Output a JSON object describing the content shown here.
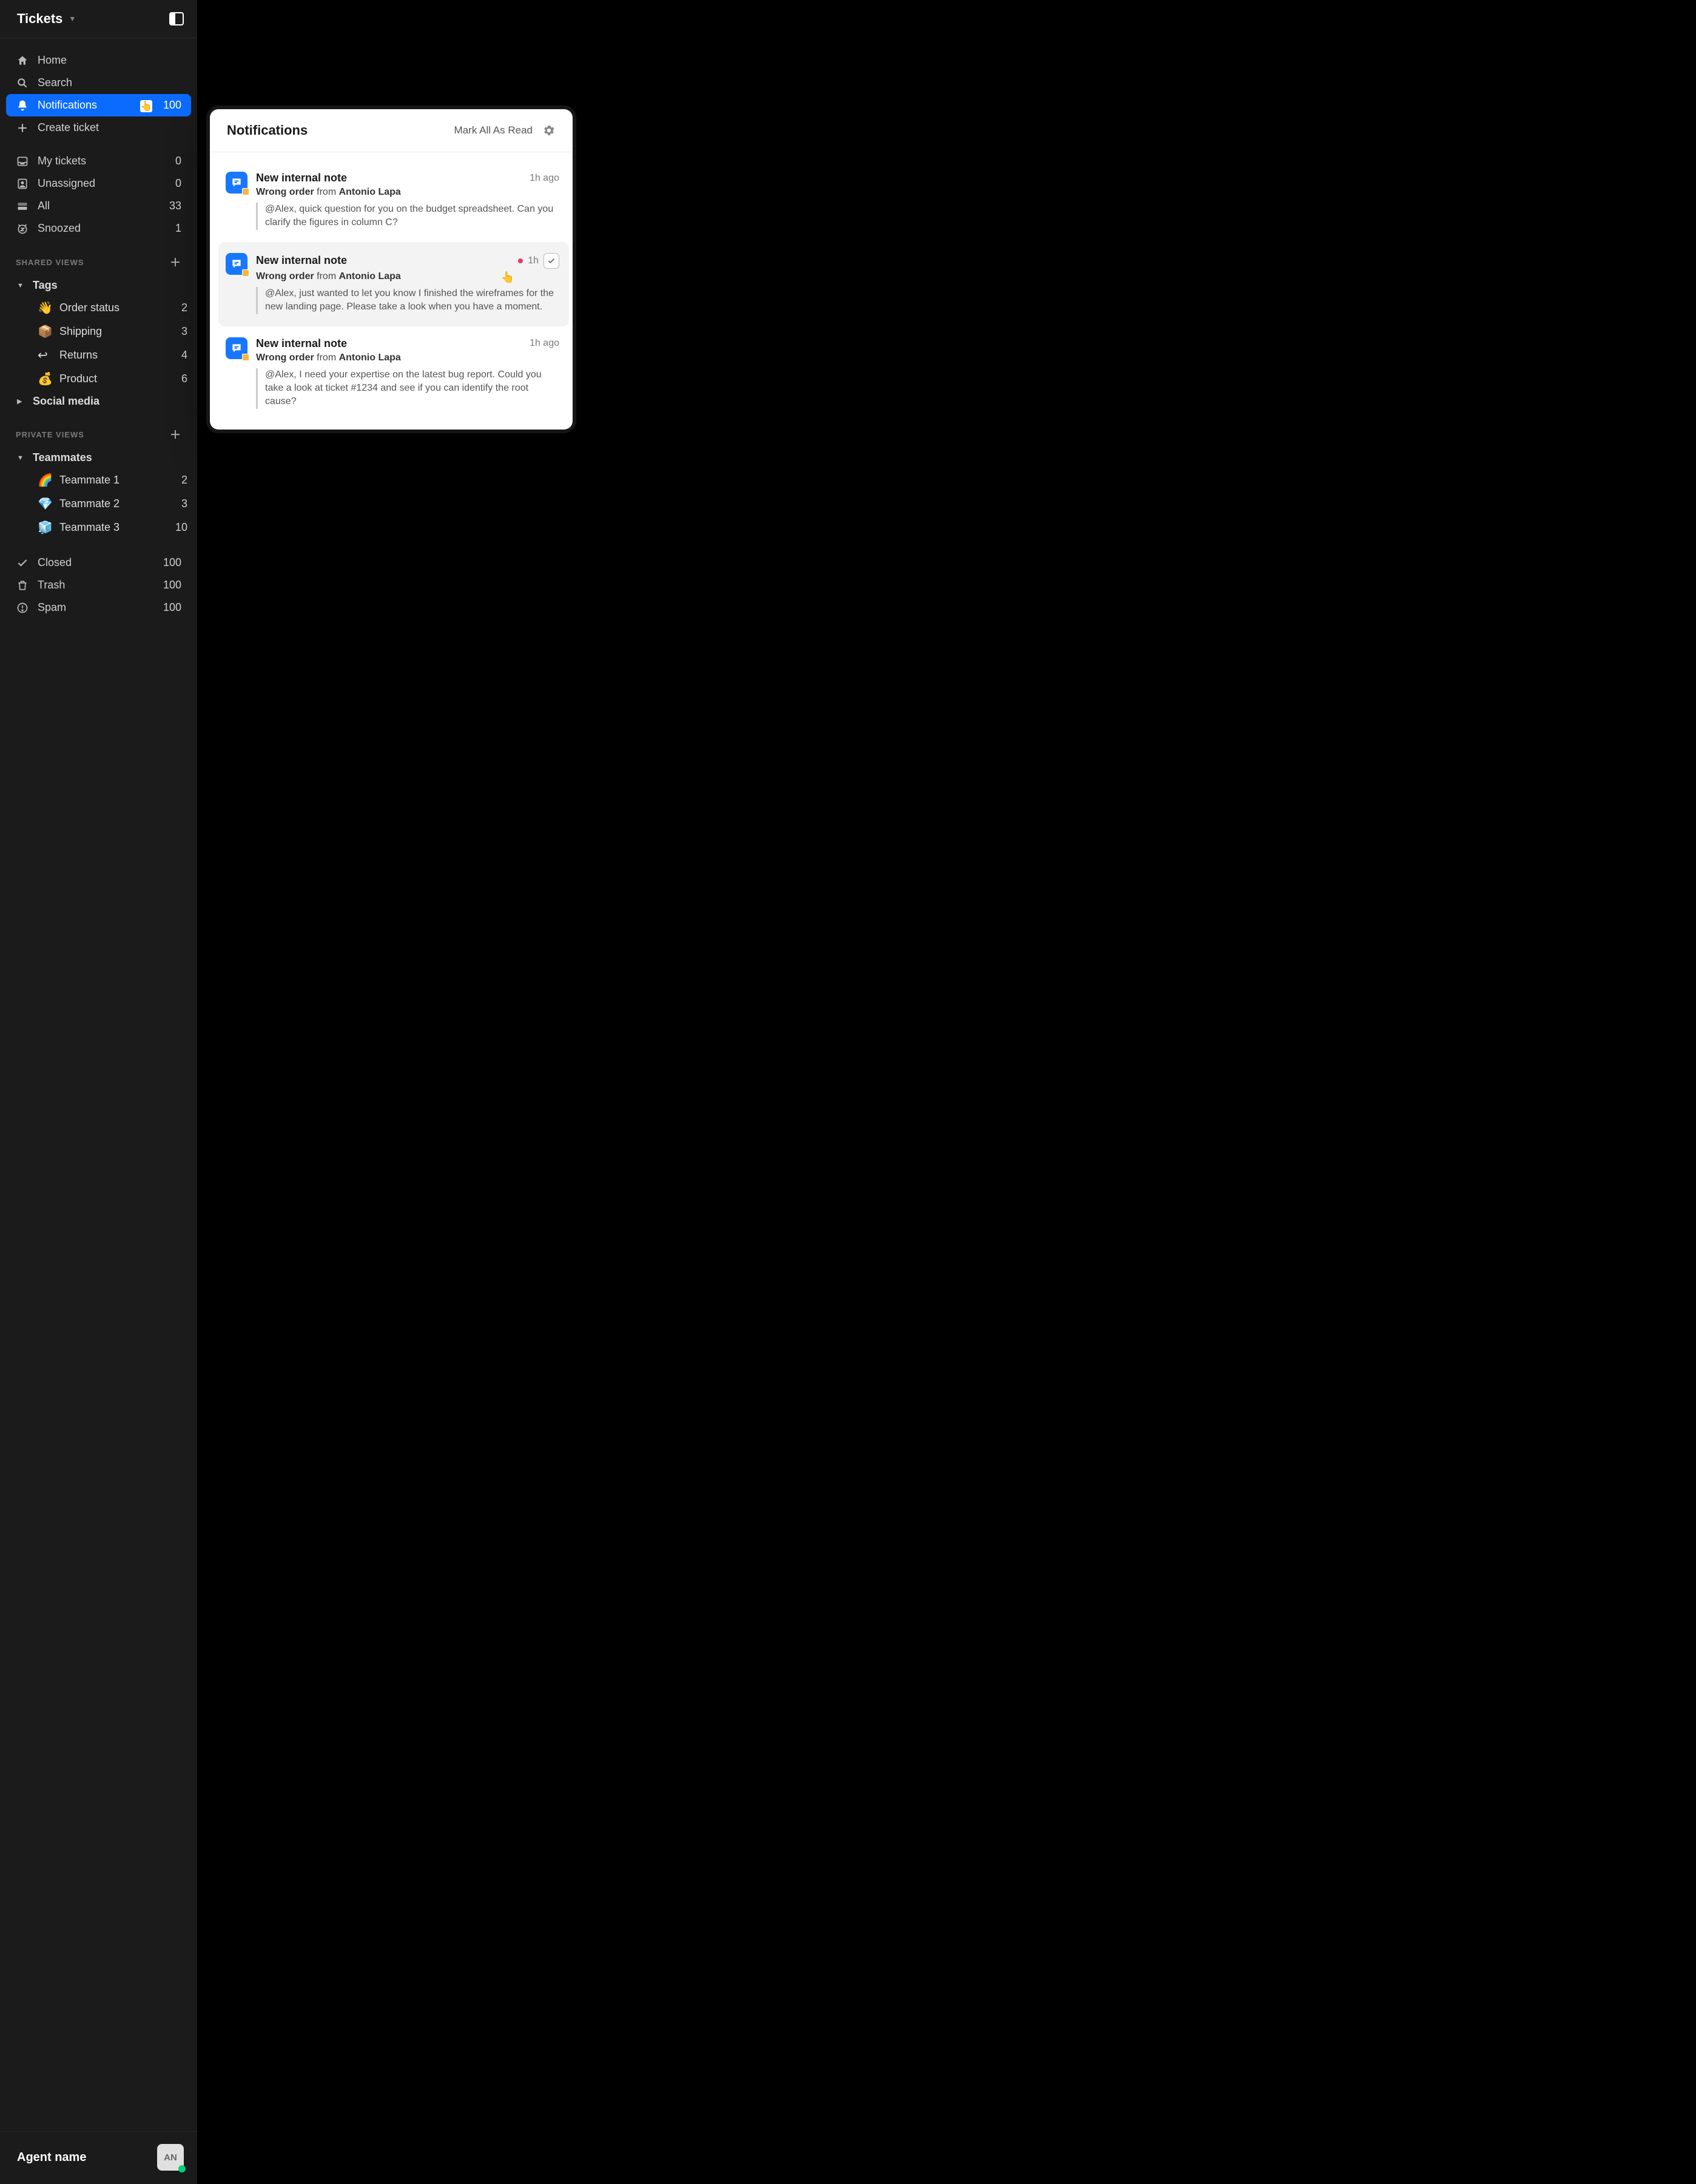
{
  "sidebar": {
    "title": "Tickets",
    "nav": [
      {
        "icon": "home",
        "label": "Home"
      },
      {
        "icon": "search",
        "label": "Search"
      },
      {
        "icon": "bell",
        "label": "Notifications",
        "count": "100",
        "active": true
      },
      {
        "icon": "plus",
        "label": "Create ticket"
      }
    ],
    "lists": [
      {
        "icon": "inbox",
        "label": "My tickets",
        "count": "0"
      },
      {
        "icon": "user-badge",
        "label": "Unassigned",
        "count": "0"
      },
      {
        "icon": "tray",
        "label": "All",
        "count": "33"
      },
      {
        "icon": "snooze",
        "label": "Snoozed",
        "count": "1"
      }
    ],
    "shared_views": {
      "label": "SHARED VIEWS",
      "groups": [
        {
          "label": "Tags",
          "expanded": true,
          "children": [
            {
              "emoji": "👋",
              "label": "Order status",
              "count": "2"
            },
            {
              "emoji": "📦",
              "label": "Shipping",
              "count": "3"
            },
            {
              "emoji": "↩",
              "label": "Returns",
              "count": "4"
            },
            {
              "emoji": "💰",
              "label": "Product",
              "count": "6"
            }
          ]
        },
        {
          "label": "Social media",
          "expanded": false
        }
      ]
    },
    "private_views": {
      "label": "PRIVATE VIEWS",
      "groups": [
        {
          "label": "Teammates",
          "expanded": true,
          "children": [
            {
              "emoji": "🌈",
              "label": "Teammate 1",
              "count": "2"
            },
            {
              "emoji": "💎",
              "label": "Teammate 2",
              "count": "3"
            },
            {
              "emoji": "🧊",
              "label": "Teammate 3",
              "count": "10"
            }
          ]
        }
      ]
    },
    "footer_nav": [
      {
        "icon": "check",
        "label": "Closed",
        "count": "100"
      },
      {
        "icon": "trash",
        "label": "Trash",
        "count": "100"
      },
      {
        "icon": "alert",
        "label": "Spam",
        "count": "100"
      }
    ],
    "agent": {
      "name": "Agent name",
      "initials": "AN",
      "status": "online"
    }
  },
  "panel": {
    "title": "Notifications",
    "mark_all": "Mark All As Read",
    "items": [
      {
        "title": "New internal note",
        "subject": "Wrong order",
        "from_label": "from",
        "from": "Antonio Lapa",
        "body": "@Alex, quick question for you on the budget spreadsheet. Can you clarify the figures in column C?",
        "time": "1h ago",
        "unread": false,
        "hover": false
      },
      {
        "title": "New internal note",
        "subject": "Wrong order",
        "from_label": "from",
        "from": "Antonio Lapa",
        "body": "@Alex, just wanted to let you know I finished the wireframes for the new landing page. Please take a look when you have a moment.",
        "time": "1h",
        "unread": true,
        "hover": true
      },
      {
        "title": "New internal note",
        "subject": "Wrong order",
        "from_label": "from",
        "from": "Antonio Lapa",
        "body": "@Alex, I need your expertise on the latest bug report. Could you take a look at ticket #1234 and see if you can identify the root cause?",
        "time": "1h ago",
        "unread": false,
        "hover": false
      }
    ]
  }
}
